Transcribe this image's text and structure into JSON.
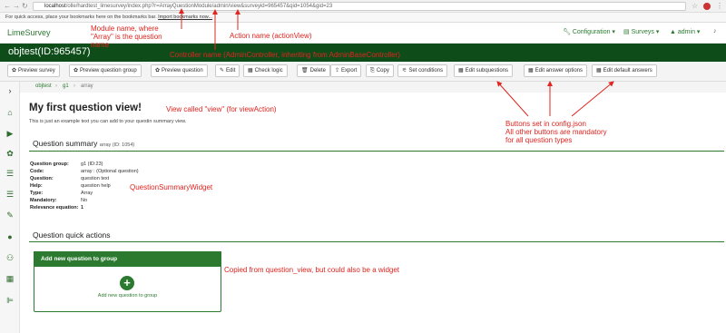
{
  "browser": {
    "url_host": "localhost",
    "url_path": "/olle/hardtest_limesurvey/index.php?r=ArrayQuestionModule/admin/view&surveyid=965457&qid=1054&gid=23",
    "bookmarks_text": "For quick access, place your bookmarks here on the bookmarks bar.",
    "bookmarks_link": "Import bookmarks now..."
  },
  "app": {
    "brand": "LimeSurvey",
    "menu": {
      "configuration": "Configuration",
      "surveys": "Surveys",
      "admin": "admin"
    },
    "title": "objtest(ID:965457)"
  },
  "toolbar": [
    {
      "icon": "gear-icon",
      "glyph": "✿",
      "label": "Preview survey"
    },
    {
      "icon": "gear-icon",
      "glyph": "✿",
      "label": "Preview question group"
    },
    {
      "icon": "gear-icon",
      "glyph": "✿",
      "label": "Preview question"
    },
    {
      "icon": "pencil-icon",
      "glyph": "✎",
      "label": "Edit"
    },
    {
      "icon": "table-icon",
      "glyph": "▦",
      "label": "Check logic"
    },
    {
      "icon": "trash-icon",
      "glyph": "🗑",
      "label": "Delete"
    },
    {
      "icon": "export-icon",
      "glyph": "⇪",
      "label": "Export"
    },
    {
      "icon": "copy-icon",
      "glyph": "⎘",
      "label": "Copy"
    },
    {
      "icon": "condition-icon",
      "glyph": "⚟",
      "label": "Set conditions"
    },
    {
      "icon": "table-icon",
      "glyph": "▦",
      "label": "Edit subquestions"
    },
    {
      "icon": "table-icon",
      "glyph": "▦",
      "label": "Edit answer options"
    },
    {
      "icon": "table-icon",
      "glyph": "▦",
      "label": "Edit default answers"
    }
  ],
  "breadcrumb": [
    "objtest",
    "g1",
    "array"
  ],
  "main": {
    "heading": "My first question view!",
    "subtext": "This is just an example text you can add to your questin summary view.",
    "summary_title": "Question summary",
    "summary_id": "array (ID: 1054)",
    "fields": [
      {
        "label": "Question group:",
        "value": "g1 (ID:23)"
      },
      {
        "label": "Code:",
        "value": "array : (Optional question)"
      },
      {
        "label": "Question:",
        "value": "question text"
      },
      {
        "label": "Help:",
        "value": "question help"
      },
      {
        "label": "Type:",
        "value": "Array"
      },
      {
        "label": "Mandatory:",
        "value": "No"
      },
      {
        "label": "Relevance equation:",
        "value": "1"
      }
    ],
    "quick_actions_title": "Question quick actions",
    "panel_title": "Add new question to group",
    "panel_link": "Add new question to group"
  },
  "annotations": {
    "module": [
      "Module name, where",
      "\"Array\" is the question",
      "name"
    ],
    "action": "Action name (actionView)",
    "controller": "Controller name (AdminController, inheriting from AdminBaseController)",
    "view": "View called \"view\" (for viewAction)",
    "buttons": [
      "Buttons set in config.json",
      "All other buttons are mandatory",
      "for all question types"
    ],
    "widget": "QuestionSummaryWidget",
    "copied": "Copied from question_view, but could also be a widget"
  },
  "colors": {
    "brand_green": "#2c7a30",
    "title_bar": "#0e4d1a",
    "annotation_red": "#e0241f"
  }
}
